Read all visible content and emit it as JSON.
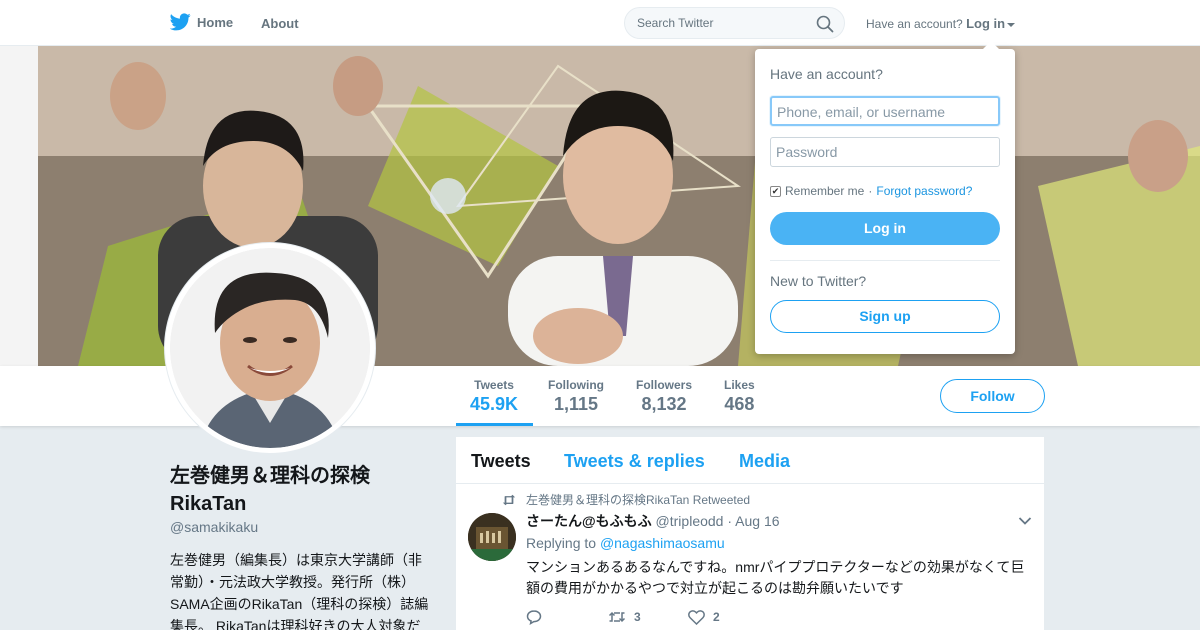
{
  "nav": {
    "home_label": "Home",
    "about_label": "About",
    "search_placeholder": "Search Twitter",
    "account_prompt": "Have an account?",
    "login_label": "Log in"
  },
  "profile": {
    "name_line1": "左巻健男＆理科の探検",
    "name_line2": "RikaTan",
    "handle": "@samakikaku",
    "bio_lines": [
      "左巻健男（編集長）は東京大学講師（非",
      "常勤）・元法政大学教授。発行所（株）",
      "SAMA企画のRikaTan（理科の探検）誌編",
      "集長。 RikaTanは理科好きの大人対象だ"
    ]
  },
  "stats": [
    {
      "label": "Tweets",
      "value": "45.9K"
    },
    {
      "label": "Following",
      "value": "1,115"
    },
    {
      "label": "Followers",
      "value": "8,132"
    },
    {
      "label": "Likes",
      "value": "468"
    }
  ],
  "follow_label": "Follow",
  "timeline": {
    "tabs": [
      "Tweets",
      "Tweets & replies",
      "Media"
    ],
    "tweet": {
      "retweet_context": "左巻健男＆理科の探検RikaTan Retweeted",
      "author": "さーたん@もふもふ",
      "username": "@tripleodd",
      "separator": "·",
      "date": "Aug 16",
      "replying_prefix": "Replying to",
      "replying_to": "@nagashimaosamu",
      "text_line1": "マンションあるあるなんですね。nmrパイププロテクターなどの効果がなくて巨",
      "text_line2": "額の費用がかかるやつで対立が起こるのは勘弁願いたいです",
      "retweets": "3",
      "likes": "2"
    }
  },
  "login_dropdown": {
    "title": "Have an account?",
    "username_placeholder": "Phone, email, or username",
    "password_placeholder": "Password",
    "remember_me": "Remember me",
    "separator": "·",
    "forgot_password": "Forgot password?",
    "login_button": "Log in",
    "new_prompt": "New to Twitter?",
    "signup_button": "Sign up"
  },
  "colors": {
    "accent": "#1da1f2",
    "login_button": "#4ab3f4",
    "background": "#e6ecf0"
  }
}
